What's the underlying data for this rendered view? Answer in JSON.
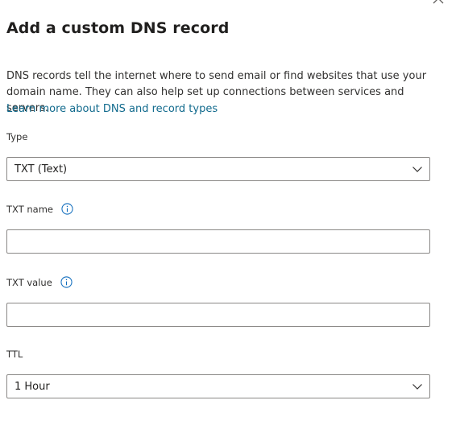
{
  "header": {
    "title": "Add a custom DNS record"
  },
  "intro": {
    "description": "DNS records tell the internet where to send email or find websites that use your domain name. They can also help set up connections between services and servers.",
    "learn_more_link": "Learn more about DNS and record types"
  },
  "fields": {
    "type": {
      "label": "Type",
      "value": "TXT (Text)"
    },
    "txt_name": {
      "label": "TXT name",
      "value": "",
      "placeholder": ""
    },
    "txt_value": {
      "label": "TXT value",
      "value": "",
      "placeholder": ""
    },
    "ttl": {
      "label": "TTL",
      "value": "1 Hour"
    }
  },
  "icons": {
    "close": "close-icon",
    "info": "info-icon",
    "dropdown": "chevron-down-icon"
  },
  "colors": {
    "link": "#116a8d",
    "info_icon": "#0f6cbd",
    "border": "#8a8886",
    "text": "#323130"
  }
}
